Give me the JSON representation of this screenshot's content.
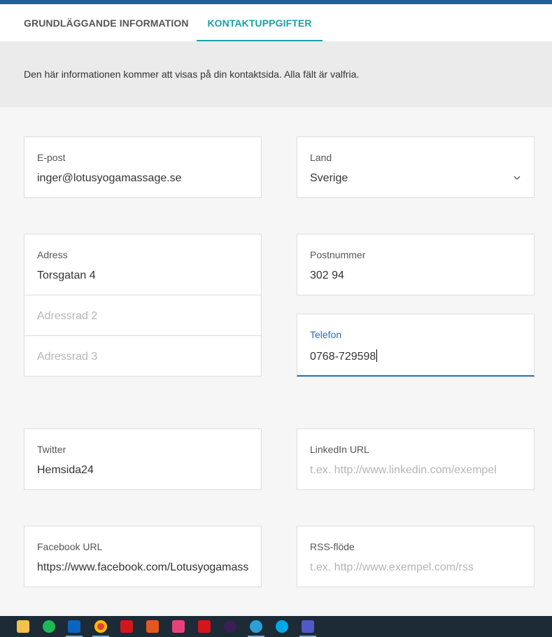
{
  "tabs": {
    "basic": "GRUNDLÄGGANDE INFORMATION",
    "contact": "KONTAKTUPPGIFTER"
  },
  "info_text": "Den här informationen kommer att visas på din kontaktsida. Alla fält är valfria.",
  "fields": {
    "email": {
      "label": "E-post",
      "value": "inger@lotusyogamassage.se"
    },
    "country": {
      "label": "Land",
      "value": "Sverige"
    },
    "address": {
      "label": "Adress",
      "value": "Torsgatan 4",
      "line2_placeholder": "Adressrad 2",
      "line3_placeholder": "Adressrad 3"
    },
    "postal": {
      "label": "Postnummer",
      "value": "302 94"
    },
    "phone": {
      "label": "Telefon",
      "value": "0768-729598"
    },
    "twitter": {
      "label": "Twitter",
      "value": "Hemsida24"
    },
    "linkedin": {
      "label": "LinkedIn URL",
      "placeholder": "t.ex. http://www.linkedin.com/exempel"
    },
    "facebook": {
      "label": "Facebook URL",
      "value": "https://www.facebook.com/Lotusyogamassage"
    },
    "rss": {
      "label": "RSS-flöde",
      "placeholder": "t.ex. http://www.exempel.com/rss"
    }
  },
  "colors": {
    "accent_teal": "#17a2a8",
    "accent_blue": "#1f6fb5",
    "topbar": "#1f5f9b",
    "taskbar": "#1c2b36"
  },
  "taskbar_icons": [
    "file-explorer-icon",
    "spotify-icon",
    "outlook-icon",
    "chrome-icon",
    "acrobat-icon",
    "office-icon",
    "creative-cloud-icon",
    "acrobat-reader-icon",
    "audition-icon",
    "edge-icon",
    "skype-icon",
    "teams-icon"
  ]
}
